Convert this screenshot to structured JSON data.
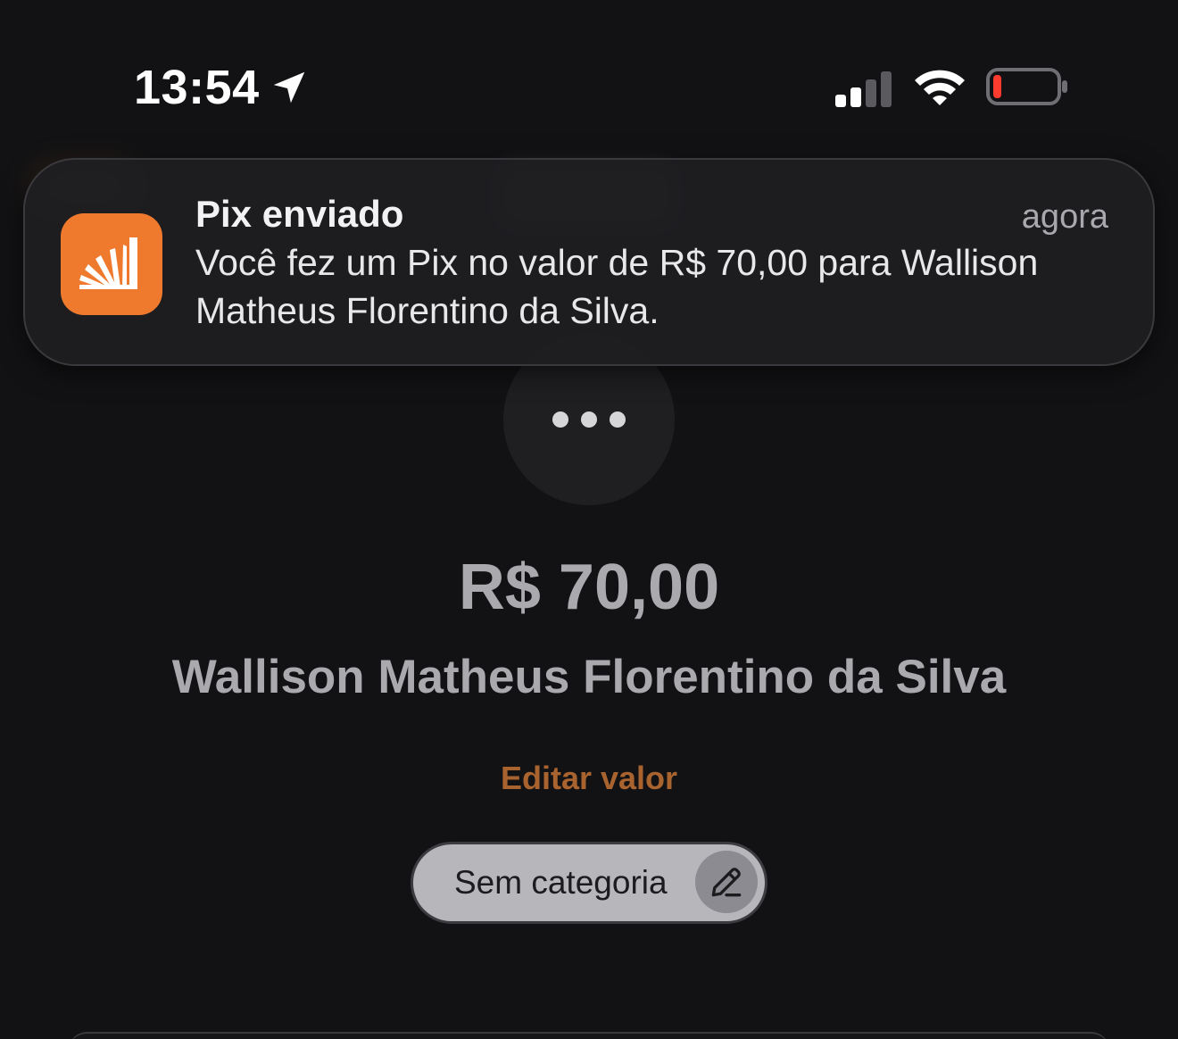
{
  "status_bar": {
    "time": "13:54",
    "location_icon": "location-arrow-icon",
    "signal_icon": "cellular-signal-icon",
    "wifi_icon": "wifi-icon",
    "battery_icon": "battery-low-icon",
    "battery_color": "#ff3b30"
  },
  "notification": {
    "app_icon": "bank-app-icon",
    "title": "Pix enviado",
    "time": "agora",
    "body": "Você fez um Pix no valor de R$ 70,00 para Wallison Matheus Florentino da Silva.",
    "icon_color": "#ef7a2e"
  },
  "transfer": {
    "more_icon": "more-dots-icon",
    "amount": "R$ 70,00",
    "recipient": "Wallison Matheus Florentino da Silva",
    "edit_value_label": "Editar valor",
    "category_label": "Sem categoria",
    "category_edit_icon": "pencil-icon",
    "accent_color": "#a9632f"
  }
}
